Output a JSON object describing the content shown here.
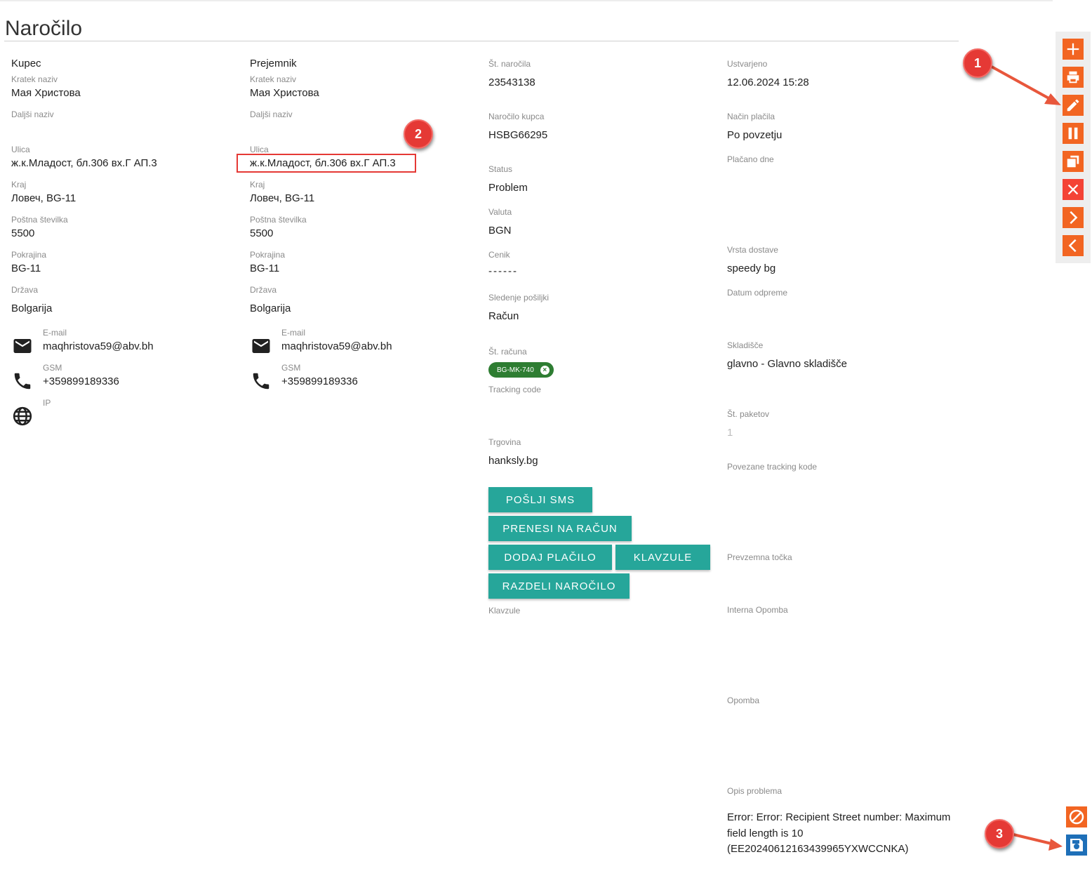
{
  "page": {
    "title": "Naročilo"
  },
  "buyer": {
    "heading": "Kupec",
    "short_name_label": "Kratek naziv",
    "short_name": "Мая Христова",
    "long_name_label": "Daljši naziv",
    "long_name": "",
    "street_label": "Ulica",
    "street": "ж.к.Младост, бл.306 вх.Г АП.3",
    "city_label": "Kraj",
    "city": "Ловеч, BG-11",
    "postal_label": "Poštna številka",
    "postal": "5500",
    "region_label": "Pokrajina",
    "region": "BG-11",
    "country_label": "Država",
    "country": "Bolgarija",
    "email_label": "E-mail",
    "email": "maqhristova59@abv.bh",
    "gsm_label": "GSM",
    "gsm": "+359899189336",
    "ip_label": "IP",
    "ip": ""
  },
  "recipient": {
    "heading": "Prejemnik",
    "short_name_label": "Kratek naziv",
    "short_name": "Мая Христова",
    "long_name_label": "Daljši naziv",
    "long_name": "",
    "street_label": "Ulica",
    "street": "ж.к.Младост, бл.306 вх.Г АП.3",
    "city_label": "Kraj",
    "city": "Ловеч, BG-11",
    "postal_label": "Poštna številka",
    "postal": "5500",
    "region_label": "Pokrajina",
    "region": "BG-11",
    "country_label": "Država",
    "country": "Bolgarija",
    "email_label": "E-mail",
    "email": "maqhristova59@abv.bh",
    "gsm_label": "GSM",
    "gsm": "+359899189336"
  },
  "order": {
    "order_no_label": "Št. naročila",
    "order_no": "23543138",
    "customer_order_label": "Naročilo kupca",
    "customer_order": "HSBG66295",
    "status_label": "Status",
    "status": "Problem",
    "currency_label": "Valuta",
    "currency": "BGN",
    "pricelist_label": "Cenik",
    "pricelist": "------",
    "tracking_label": "Sledenje pošiljki",
    "tracking": "Račun",
    "invoice_no_label": "Št. računa",
    "invoice_chip": "BG-MK-740",
    "tracking_code_label": "Tracking code",
    "tracking_code": "",
    "shop_label": "Trgovina",
    "shop": "hanksly.bg",
    "clauses_label": "Klavzule"
  },
  "buttons": {
    "send_sms": "POŠLJI SMS",
    "transfer_invoice": "PRENESI NA RAČUN",
    "add_payment": "DODAJ PLAČILO",
    "clauses": "KLAVZULE",
    "split_order": "RAZDELI NAROČILO"
  },
  "details": {
    "created_label": "Ustvarjeno",
    "created": "12.06.2024 15:28",
    "payment_method_label": "Način plačila",
    "payment_method": "Po povzetju",
    "paid_on_label": "Plačano dne",
    "paid_on": "",
    "delivery_type_label": "Vrsta dostave",
    "delivery_type": "speedy bg",
    "ship_date_label": "Datum odpreme",
    "ship_date": "",
    "warehouse_label": "Skladišče",
    "warehouse": "glavno - Glavno skladišče",
    "packages_label": "Št. paketov",
    "packages": "1",
    "linked_tracking_label": "Povezane tracking kode",
    "pickup_point_label": "Prevzemna točka",
    "internal_note_label": "Interna Opomba",
    "note_label": "Opomba",
    "problem_label": "Opis problema",
    "problem": "Error: Error: Recipient Street number: Maximum field length is 10 (EE20240612163439965YXWCCNKA)"
  },
  "toolbar": {
    "icons": [
      "plus-icon",
      "print-icon",
      "edit-icon",
      "pause-icon",
      "copy-icon",
      "close-icon",
      "next-icon",
      "prev-icon"
    ]
  },
  "annotations": {
    "badge1": "1",
    "badge2": "2",
    "badge3": "3"
  },
  "colors": {
    "accent_orange": "#f26522",
    "teal": "#26a69a",
    "chip_green": "#2e7d32",
    "callout_red": "#e53935",
    "save_blue": "#1e6fb8"
  }
}
